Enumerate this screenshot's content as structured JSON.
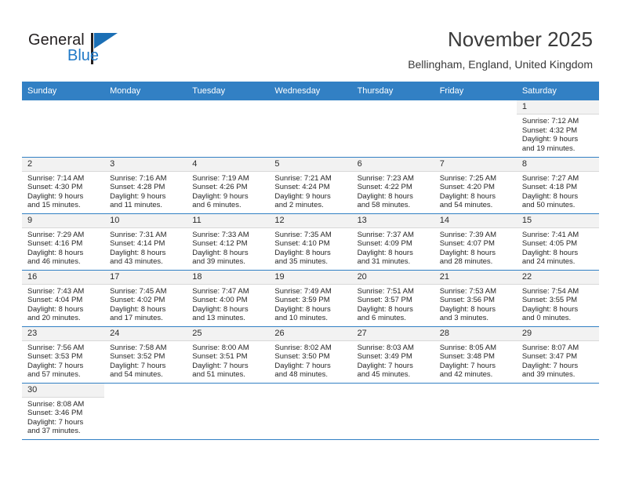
{
  "brand": {
    "name_top": "General",
    "name_bottom": "Blue",
    "accent_color": "#2079c7",
    "logo_icon": "triangle-logo-icon"
  },
  "header": {
    "title": "November 2025",
    "subtitle": "Bellingham, England, United Kingdom"
  },
  "calendar": {
    "header_bg": "#3280c4",
    "daynum_bg": "#f2f2f2",
    "weekdays": [
      "Sunday",
      "Monday",
      "Tuesday",
      "Wednesday",
      "Thursday",
      "Friday",
      "Saturday"
    ],
    "weeks": [
      [
        {
          "empty": true
        },
        {
          "empty": true
        },
        {
          "empty": true
        },
        {
          "empty": true
        },
        {
          "empty": true
        },
        {
          "empty": true
        },
        {
          "day": "1",
          "sunrise": "Sunrise: 7:12 AM",
          "sunset": "Sunset: 4:32 PM",
          "daylight1": "Daylight: 9 hours",
          "daylight2": "and 19 minutes."
        }
      ],
      [
        {
          "day": "2",
          "sunrise": "Sunrise: 7:14 AM",
          "sunset": "Sunset: 4:30 PM",
          "daylight1": "Daylight: 9 hours",
          "daylight2": "and 15 minutes."
        },
        {
          "day": "3",
          "sunrise": "Sunrise: 7:16 AM",
          "sunset": "Sunset: 4:28 PM",
          "daylight1": "Daylight: 9 hours",
          "daylight2": "and 11 minutes."
        },
        {
          "day": "4",
          "sunrise": "Sunrise: 7:19 AM",
          "sunset": "Sunset: 4:26 PM",
          "daylight1": "Daylight: 9 hours",
          "daylight2": "and 6 minutes."
        },
        {
          "day": "5",
          "sunrise": "Sunrise: 7:21 AM",
          "sunset": "Sunset: 4:24 PM",
          "daylight1": "Daylight: 9 hours",
          "daylight2": "and 2 minutes."
        },
        {
          "day": "6",
          "sunrise": "Sunrise: 7:23 AM",
          "sunset": "Sunset: 4:22 PM",
          "daylight1": "Daylight: 8 hours",
          "daylight2": "and 58 minutes."
        },
        {
          "day": "7",
          "sunrise": "Sunrise: 7:25 AM",
          "sunset": "Sunset: 4:20 PM",
          "daylight1": "Daylight: 8 hours",
          "daylight2": "and 54 minutes."
        },
        {
          "day": "8",
          "sunrise": "Sunrise: 7:27 AM",
          "sunset": "Sunset: 4:18 PM",
          "daylight1": "Daylight: 8 hours",
          "daylight2": "and 50 minutes."
        }
      ],
      [
        {
          "day": "9",
          "sunrise": "Sunrise: 7:29 AM",
          "sunset": "Sunset: 4:16 PM",
          "daylight1": "Daylight: 8 hours",
          "daylight2": "and 46 minutes."
        },
        {
          "day": "10",
          "sunrise": "Sunrise: 7:31 AM",
          "sunset": "Sunset: 4:14 PM",
          "daylight1": "Daylight: 8 hours",
          "daylight2": "and 43 minutes."
        },
        {
          "day": "11",
          "sunrise": "Sunrise: 7:33 AM",
          "sunset": "Sunset: 4:12 PM",
          "daylight1": "Daylight: 8 hours",
          "daylight2": "and 39 minutes."
        },
        {
          "day": "12",
          "sunrise": "Sunrise: 7:35 AM",
          "sunset": "Sunset: 4:10 PM",
          "daylight1": "Daylight: 8 hours",
          "daylight2": "and 35 minutes."
        },
        {
          "day": "13",
          "sunrise": "Sunrise: 7:37 AM",
          "sunset": "Sunset: 4:09 PM",
          "daylight1": "Daylight: 8 hours",
          "daylight2": "and 31 minutes."
        },
        {
          "day": "14",
          "sunrise": "Sunrise: 7:39 AM",
          "sunset": "Sunset: 4:07 PM",
          "daylight1": "Daylight: 8 hours",
          "daylight2": "and 28 minutes."
        },
        {
          "day": "15",
          "sunrise": "Sunrise: 7:41 AM",
          "sunset": "Sunset: 4:05 PM",
          "daylight1": "Daylight: 8 hours",
          "daylight2": "and 24 minutes."
        }
      ],
      [
        {
          "day": "16",
          "sunrise": "Sunrise: 7:43 AM",
          "sunset": "Sunset: 4:04 PM",
          "daylight1": "Daylight: 8 hours",
          "daylight2": "and 20 minutes."
        },
        {
          "day": "17",
          "sunrise": "Sunrise: 7:45 AM",
          "sunset": "Sunset: 4:02 PM",
          "daylight1": "Daylight: 8 hours",
          "daylight2": "and 17 minutes."
        },
        {
          "day": "18",
          "sunrise": "Sunrise: 7:47 AM",
          "sunset": "Sunset: 4:00 PM",
          "daylight1": "Daylight: 8 hours",
          "daylight2": "and 13 minutes."
        },
        {
          "day": "19",
          "sunrise": "Sunrise: 7:49 AM",
          "sunset": "Sunset: 3:59 PM",
          "daylight1": "Daylight: 8 hours",
          "daylight2": "and 10 minutes."
        },
        {
          "day": "20",
          "sunrise": "Sunrise: 7:51 AM",
          "sunset": "Sunset: 3:57 PM",
          "daylight1": "Daylight: 8 hours",
          "daylight2": "and 6 minutes."
        },
        {
          "day": "21",
          "sunrise": "Sunrise: 7:53 AM",
          "sunset": "Sunset: 3:56 PM",
          "daylight1": "Daylight: 8 hours",
          "daylight2": "and 3 minutes."
        },
        {
          "day": "22",
          "sunrise": "Sunrise: 7:54 AM",
          "sunset": "Sunset: 3:55 PM",
          "daylight1": "Daylight: 8 hours",
          "daylight2": "and 0 minutes."
        }
      ],
      [
        {
          "day": "23",
          "sunrise": "Sunrise: 7:56 AM",
          "sunset": "Sunset: 3:53 PM",
          "daylight1": "Daylight: 7 hours",
          "daylight2": "and 57 minutes."
        },
        {
          "day": "24",
          "sunrise": "Sunrise: 7:58 AM",
          "sunset": "Sunset: 3:52 PM",
          "daylight1": "Daylight: 7 hours",
          "daylight2": "and 54 minutes."
        },
        {
          "day": "25",
          "sunrise": "Sunrise: 8:00 AM",
          "sunset": "Sunset: 3:51 PM",
          "daylight1": "Daylight: 7 hours",
          "daylight2": "and 51 minutes."
        },
        {
          "day": "26",
          "sunrise": "Sunrise: 8:02 AM",
          "sunset": "Sunset: 3:50 PM",
          "daylight1": "Daylight: 7 hours",
          "daylight2": "and 48 minutes."
        },
        {
          "day": "27",
          "sunrise": "Sunrise: 8:03 AM",
          "sunset": "Sunset: 3:49 PM",
          "daylight1": "Daylight: 7 hours",
          "daylight2": "and 45 minutes."
        },
        {
          "day": "28",
          "sunrise": "Sunrise: 8:05 AM",
          "sunset": "Sunset: 3:48 PM",
          "daylight1": "Daylight: 7 hours",
          "daylight2": "and 42 minutes."
        },
        {
          "day": "29",
          "sunrise": "Sunrise: 8:07 AM",
          "sunset": "Sunset: 3:47 PM",
          "daylight1": "Daylight: 7 hours",
          "daylight2": "and 39 minutes."
        }
      ],
      [
        {
          "day": "30",
          "sunrise": "Sunrise: 8:08 AM",
          "sunset": "Sunset: 3:46 PM",
          "daylight1": "Daylight: 7 hours",
          "daylight2": "and 37 minutes."
        },
        {
          "empty": true
        },
        {
          "empty": true
        },
        {
          "empty": true
        },
        {
          "empty": true
        },
        {
          "empty": true
        },
        {
          "empty": true
        }
      ]
    ]
  }
}
